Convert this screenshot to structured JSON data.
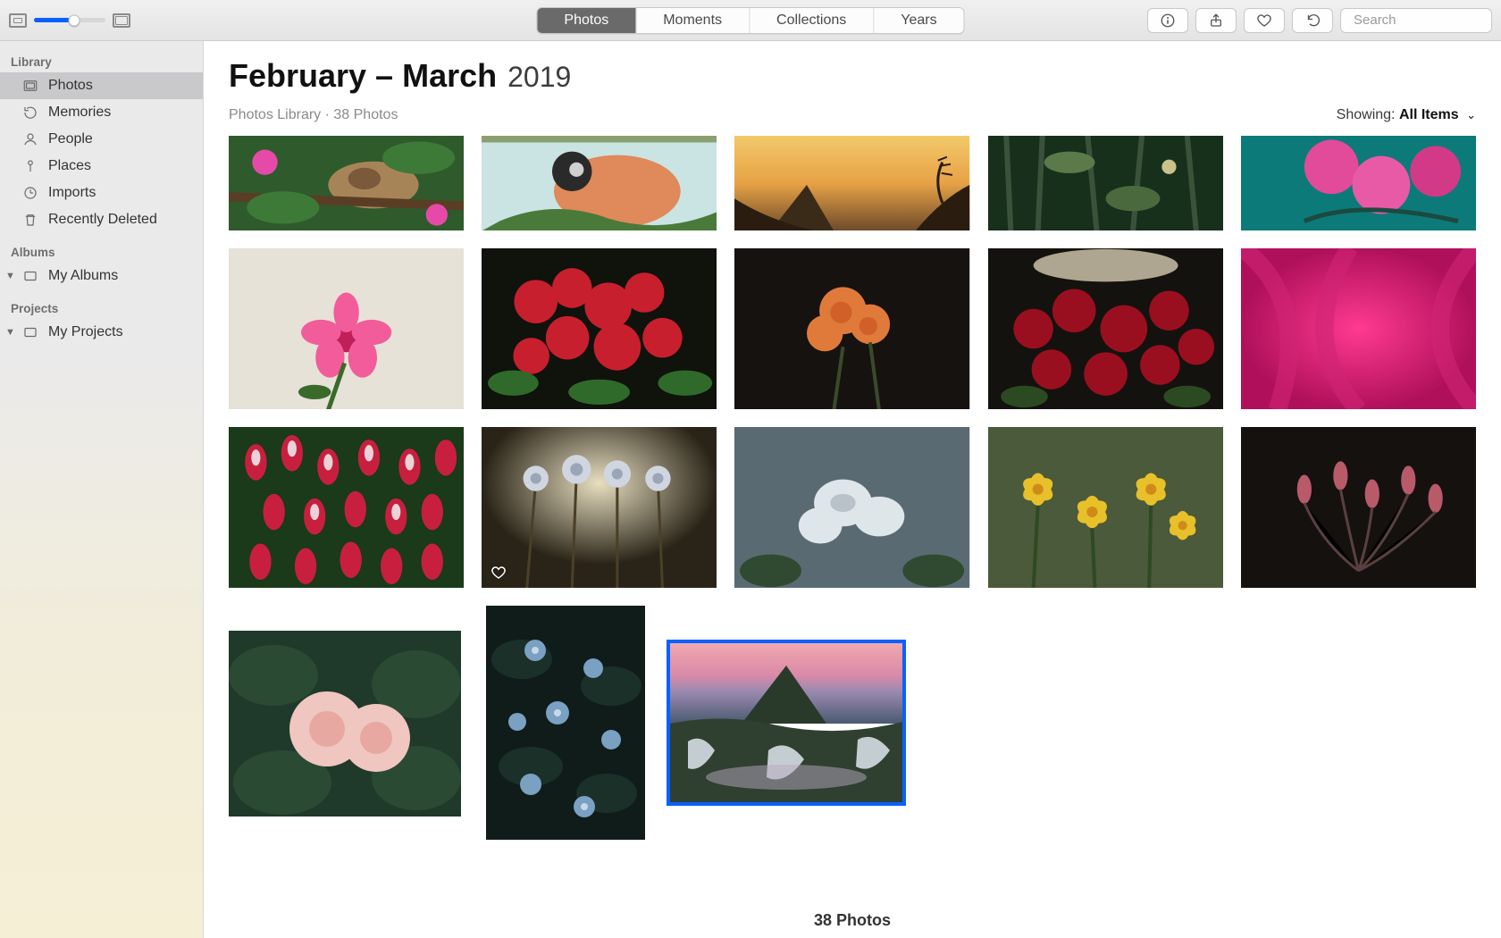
{
  "toolbar": {
    "tabs": [
      "Photos",
      "Moments",
      "Collections",
      "Years"
    ],
    "active_tab_index": 0,
    "search_placeholder": "Search"
  },
  "sidebar": {
    "sections": [
      {
        "heading": "Library",
        "items": [
          {
            "label": "Photos",
            "icon": "photos-icon",
            "selected": true
          },
          {
            "label": "Memories",
            "icon": "memories-icon"
          },
          {
            "label": "People",
            "icon": "people-icon"
          },
          {
            "label": "Places",
            "icon": "places-icon"
          },
          {
            "label": "Imports",
            "icon": "imports-icon"
          },
          {
            "label": "Recently Deleted",
            "icon": "trash-icon"
          }
        ]
      },
      {
        "heading": "Albums",
        "items": [
          {
            "label": "My Albums",
            "icon": "album-icon",
            "disclosure": true
          }
        ]
      },
      {
        "heading": "Projects",
        "items": [
          {
            "label": "My Projects",
            "icon": "album-icon",
            "disclosure": true
          }
        ]
      }
    ]
  },
  "header": {
    "title_range": "February – March",
    "title_year": "2019",
    "breadcrumb": "Photos Library · 38 Photos",
    "showing_label": "Showing:",
    "showing_value": "All Items"
  },
  "grid": {
    "row1": [
      {
        "name": "squirrel-on-branch"
      },
      {
        "name": "bullfinch-bird"
      },
      {
        "name": "sunset-rock-silhouette"
      },
      {
        "name": "wet-forest-branches"
      },
      {
        "name": "pink-orchid"
      }
    ],
    "row2": [
      {
        "name": "single-pink-flower"
      },
      {
        "name": "red-bougainvillea"
      },
      {
        "name": "orange-marigold-dark"
      },
      {
        "name": "red-roses-bush"
      },
      {
        "name": "magenta-petals-macro"
      }
    ],
    "row3": [
      {
        "name": "tulip-field-red-white"
      },
      {
        "name": "thistle-backlit",
        "favorite": true
      },
      {
        "name": "white-geranium-soft"
      },
      {
        "name": "yellow-narcissus"
      },
      {
        "name": "dark-buds"
      }
    ],
    "row4": [
      {
        "name": "pink-peonies-green"
      },
      {
        "name": "blue-wildflowers-portrait"
      },
      {
        "name": "iceland-waterfall-sunset",
        "selected": true
      }
    ]
  },
  "footer": {
    "count_text": "38 Photos"
  }
}
